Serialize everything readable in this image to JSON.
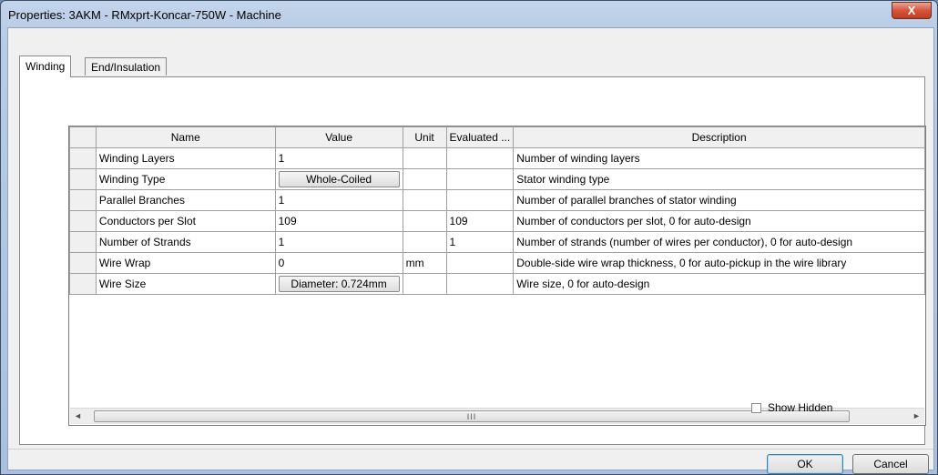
{
  "window": {
    "title": "Properties: 3AKM - RMxprt-Koncar-750W - Machine",
    "close_glyph": "X"
  },
  "tabs": [
    {
      "label": "Winding",
      "active": true
    },
    {
      "label": "End/Insulation",
      "active": false
    }
  ],
  "grid": {
    "columns": [
      "Name",
      "Value",
      "Unit",
      "Evaluated ...",
      "Description"
    ],
    "rows": [
      {
        "name": "Winding Layers",
        "value": "1",
        "value_is_button": false,
        "unit": "",
        "evaluated": "",
        "description": "Number of winding layers"
      },
      {
        "name": "Winding Type",
        "value": "Whole-Coiled",
        "value_is_button": true,
        "unit": "",
        "evaluated": "",
        "description": "Stator winding type"
      },
      {
        "name": "Parallel Branches",
        "value": "1",
        "value_is_button": false,
        "unit": "",
        "evaluated": "",
        "description": "Number of parallel branches of stator winding"
      },
      {
        "name": "Conductors per Slot",
        "value": "109",
        "value_is_button": false,
        "unit": "",
        "evaluated": "109",
        "description": "Number of conductors per slot, 0 for auto-design"
      },
      {
        "name": "Number of Strands",
        "value": "1",
        "value_is_button": false,
        "unit": "",
        "evaluated": "1",
        "description": "Number of strands (number of wires per conductor), 0 for auto-design"
      },
      {
        "name": "Wire Wrap",
        "value": "0",
        "value_is_button": false,
        "unit": "mm",
        "evaluated": "",
        "description": "Double-side wire wrap thickness, 0 for auto-pickup in the wire library"
      },
      {
        "name": "Wire Size",
        "value": "Diameter:  0.724mm",
        "value_is_button": true,
        "unit": "",
        "evaluated": "",
        "description": "Wire size, 0 for auto-design"
      }
    ],
    "scroll": {
      "left_arrow": "◄",
      "right_arrow": "►",
      "grip": "III"
    }
  },
  "show_hidden": {
    "label": "Show Hidden",
    "checked": false
  },
  "buttons": {
    "ok": "OK",
    "cancel": "Cancel"
  }
}
